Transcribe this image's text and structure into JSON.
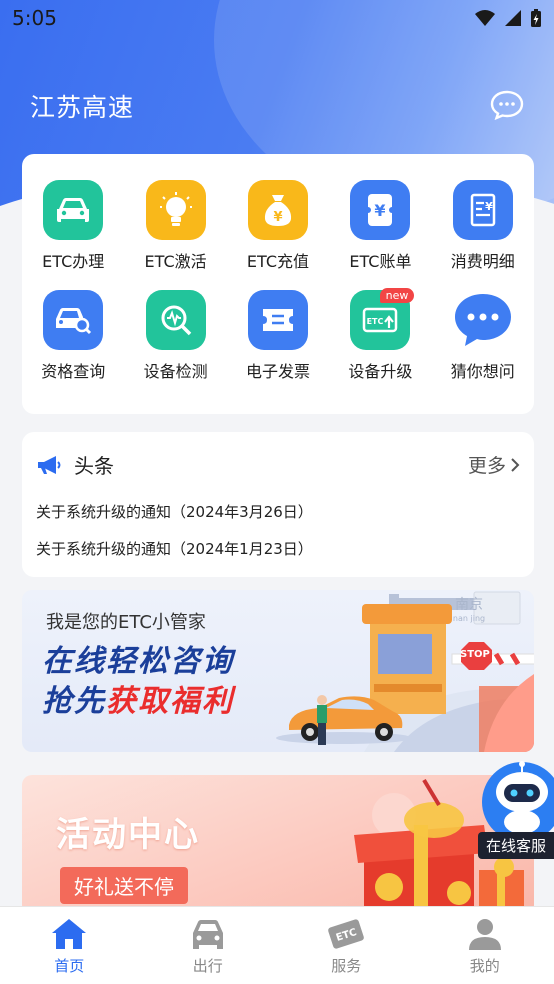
{
  "status": {
    "time": "5:05"
  },
  "header": {
    "title": "江苏高速"
  },
  "grid": [
    {
      "label": "ETC办理",
      "icon": "car-icon",
      "color": "#22c49b"
    },
    {
      "label": "ETC激活",
      "icon": "lightbulb-icon",
      "color": "#f9b81a"
    },
    {
      "label": "ETC充值",
      "icon": "money-bag-icon",
      "color": "#f9b81a"
    },
    {
      "label": "ETC账单",
      "icon": "bill-icon",
      "color": "#3f7df2"
    },
    {
      "label": "消费明细",
      "icon": "receipt-icon",
      "color": "#3f7df2"
    },
    {
      "label": "资格查询",
      "icon": "car-search-icon",
      "color": "#3f7df2"
    },
    {
      "label": "设备检测",
      "icon": "device-check-icon",
      "color": "#22c49b"
    },
    {
      "label": "电子发票",
      "icon": "invoice-icon",
      "color": "#3f7df2"
    },
    {
      "label": "设备升级",
      "icon": "etc-upgrade-icon",
      "color": "#22c49b",
      "badge": "new"
    },
    {
      "label": "猜你想问",
      "icon": "chat-bubble-icon",
      "color": "#3f7df2"
    }
  ],
  "news": {
    "title": "头条",
    "more": "更多",
    "items": [
      "关于系统升级的通知（2024年3月26日）",
      "关于系统升级的通知（2024年1月23日）"
    ]
  },
  "banner1": {
    "subtitle": "我是您的ETC小管家",
    "line1": "在线轻松咨询",
    "line2_a": "抢先",
    "line2_b": "获取福利",
    "city_sign": "南京",
    "city_sign_pinyin": "nan jing",
    "stop_sign": "STOP"
  },
  "banner2": {
    "title": "活动中心",
    "button": "好礼送不停"
  },
  "service": {
    "label": "在线客服"
  },
  "tabs": [
    {
      "label": "首页",
      "icon": "home-icon",
      "active": true
    },
    {
      "label": "出行",
      "icon": "car-front-icon",
      "active": false
    },
    {
      "label": "服务",
      "icon": "etc-tag-icon",
      "active": false
    },
    {
      "label": "我的",
      "icon": "user-icon",
      "active": false
    }
  ]
}
